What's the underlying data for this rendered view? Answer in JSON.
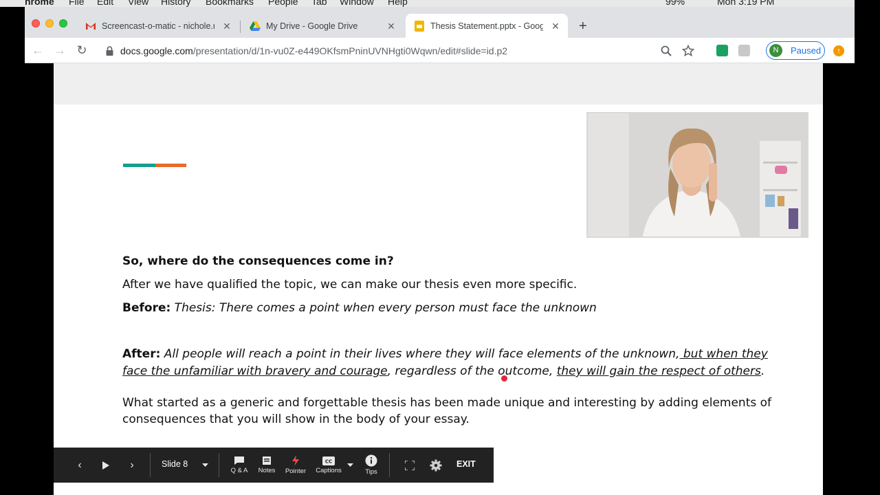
{
  "menubar": {
    "items": [
      "hrome",
      "File",
      "Edit",
      "View",
      "History",
      "Bookmarks",
      "People",
      "Tab",
      "Window",
      "Help"
    ],
    "battery": "99%",
    "clock": "Mon 3:19 PM"
  },
  "tabs": [
    {
      "title": "Screencast-o-matic - nichole.r",
      "icon": "gmail-icon",
      "active": false
    },
    {
      "title": "My Drive - Google Drive",
      "icon": "google-drive-icon",
      "active": false
    },
    {
      "title": "Thesis Statement.pptx - Google",
      "icon": "google-slides-icon",
      "active": true
    }
  ],
  "address_bar": {
    "domain": "docs.google.com",
    "path": "/presentation/d/1n-vu0Z-e449OKfsmPninUVNHgti0Wqwn/edit#slide=id.p2"
  },
  "profile": {
    "initial": "N",
    "label": "Paused"
  },
  "slide": {
    "heading": "So, where do the consequences come in?",
    "line1": "After we have qualified the topic, we can make our thesis even more specific.",
    "before_label": "Before:",
    "before_text": " Thesis:  There comes a point when every person must face the unknown",
    "after_label": "After:",
    "after_text_1": "  All people will reach a point in their lives where they will face elements of the unknown,",
    "after_text_2": " but when they",
    "after_text_3": "face the unfamiliar with bravery and courage",
    "after_text_4": ", regardless of the outcome, ",
    "after_text_5": "they will gain the respect of others",
    "after_text_6": ".",
    "closing_1": "What started as a generic and forgettable thesis has been made unique and interesting by adding elements of",
    "closing_2": "consequences that you will show in the body of your essay."
  },
  "controls": {
    "slide_label": "Slide 8",
    "qa": "Q & A",
    "notes": "Notes",
    "pointer": "Pointer",
    "captions": "Captions",
    "tips": "Tips",
    "exit": "EXIT"
  }
}
